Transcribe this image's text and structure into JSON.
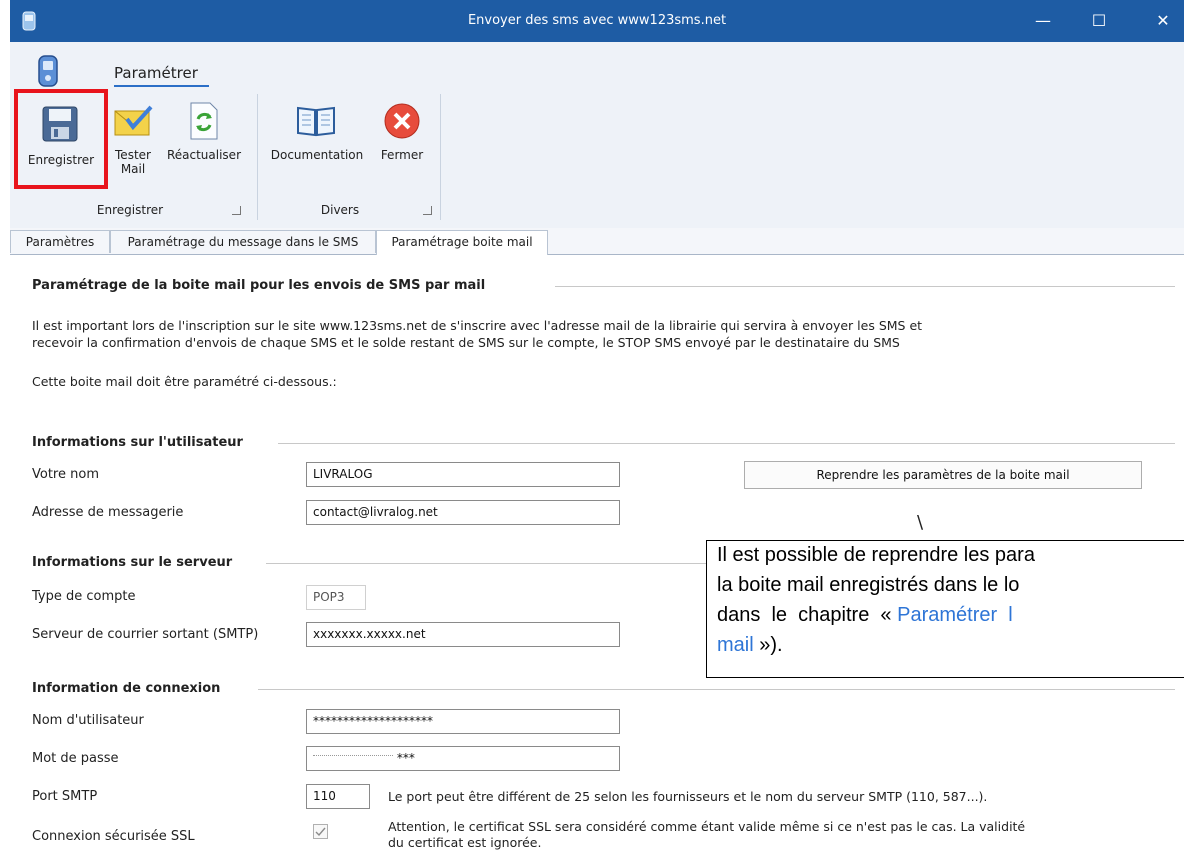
{
  "window": {
    "title": "Envoyer des sms avec www123sms.net",
    "minimize": "—",
    "maximize": "☐",
    "close": "✕"
  },
  "ribbon": {
    "tab_label": "Paramétrer",
    "group_enregistrer": {
      "label": "Enregistrer",
      "buttons": [
        "Enregistrer",
        "Tester",
        "Mail",
        "Réactualiser"
      ]
    },
    "group_divers": {
      "label": "Divers",
      "buttons": [
        "Documentation",
        "Fermer"
      ]
    }
  },
  "tabs": [
    "Paramètres",
    "Paramétrage du message dans le SMS",
    "Paramétrage boite mail"
  ],
  "content": {
    "heading": "Paramétrage de la boite mail pour les envois de SMS par mail",
    "paragraph_line1": "Il est important lors de l'inscription sur le site www.123sms.net de s'inscrire avec l'adresse mail de la librairie qui servira à envoyer les SMS et",
    "paragraph_line2": "recevoir la confirmation d'envois de chaque SMS et le solde restant de SMS sur le compte, le STOP SMS envoyé par le destinataire du SMS",
    "paragraph_line3": "Cette boite mail doit être paramétré ci-dessous.:",
    "section_user": "Informations sur l'utilisateur",
    "label_nom": "Votre nom",
    "value_nom": "LIVRALOG",
    "label_email": "Adresse de messagerie",
    "value_email": "contact@livralog.net",
    "reprendre_button": "Reprendre les paramètres de la boite mail",
    "section_server": "Informations sur le serveur",
    "label_type": "Type de compte",
    "value_type": "POP3",
    "label_smtp": "Serveur de courrier sortant (SMTP)",
    "value_smtp": "xxxxxxx.xxxxx.net",
    "section_connexion": "Information de connexion",
    "label_user": "Nom d'utilisateur",
    "value_user": "********************",
    "label_pass": "Mot de passe",
    "value_pass": "***",
    "label_port": "Port SMTP",
    "value_port": "110",
    "port_note": "Le port peut être différent de 25 selon les fournisseurs et le nom du serveur SMTP (110, 587...).",
    "label_ssl": "Connexion sécurisée SSL",
    "ssl_checked": true,
    "ssl_note_line1": "Attention, le certificat SSL sera considéré comme étant valide même si ce n'est pas le cas. La validité",
    "ssl_note_line2": "du certificat est ignorée."
  },
  "callout": {
    "connector": "\\",
    "line1": "Il est possible de reprendre les para",
    "line2": "la boite mail enregistrés dans le lo",
    "line3_prefix": "dans  le  chapitre  « ",
    "line3_link": "Paramétrer  l",
    "line4_link": "mail",
    "line4_suffix": " »)."
  },
  "colors": {
    "titlebar": "#1e5ca4",
    "highlight": "#e8141c",
    "link": "#2e75d6"
  }
}
